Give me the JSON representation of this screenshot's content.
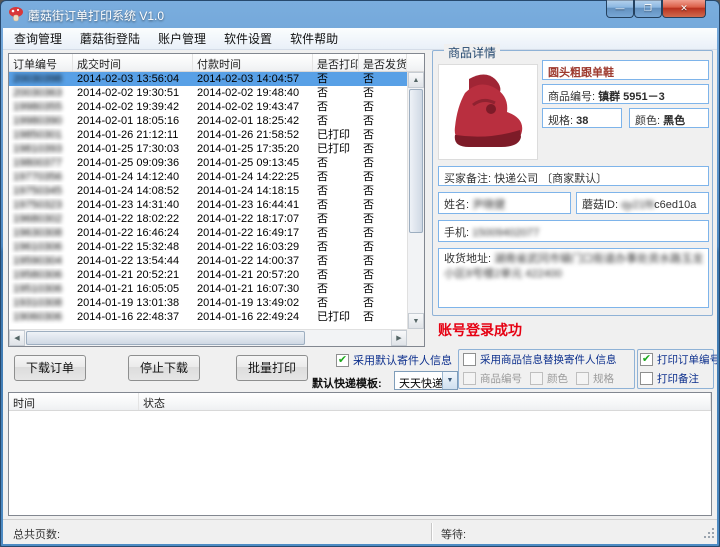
{
  "window": {
    "title": "蘑菇街订单打印系统 V1.0",
    "controls": {
      "minimize": "—",
      "maximize": "❐",
      "close": "✕"
    }
  },
  "menu": {
    "items": [
      "查询管理",
      "蘑菇街登陆",
      "账户管理",
      "软件设置",
      "软件帮助"
    ]
  },
  "orders": {
    "columns": [
      "订单编号",
      "成交时间",
      "付款时间",
      "是否打印",
      "是否发货"
    ],
    "selected_index": 0,
    "rows": [
      [
        "20030398",
        "2014-02-03 13:56:04",
        "2014-02-03 14:04:57",
        "否",
        "否"
      ],
      [
        "20030363",
        "2014-02-02 19:30:51",
        "2014-02-02 19:48:40",
        "否",
        "否"
      ],
      [
        "19980355",
        "2014-02-02 19:39:42",
        "2014-02-02 19:43:47",
        "否",
        "否"
      ],
      [
        "19980390",
        "2014-02-01 18:05:16",
        "2014-02-01 18:25:42",
        "否",
        "否"
      ],
      [
        "19850301",
        "2014-01-26 21:12:11",
        "2014-01-26 21:58:52",
        "已打印",
        "否"
      ],
      [
        "19810393",
        "2014-01-25 17:30:03",
        "2014-01-25 17:35:20",
        "已打印",
        "否"
      ],
      [
        "19800377",
        "2014-01-25 09:09:36",
        "2014-01-25 09:13:45",
        "否",
        "否"
      ],
      [
        "19770356",
        "2014-01-24 14:12:40",
        "2014-01-24 14:22:25",
        "否",
        "否"
      ],
      [
        "19750345",
        "2014-01-24 14:08:52",
        "2014-01-24 14:18:15",
        "否",
        "否"
      ],
      [
        "19750323",
        "2014-01-23 14:31:40",
        "2014-01-23 16:44:41",
        "否",
        "否"
      ],
      [
        "19680302",
        "2014-01-22 18:02:22",
        "2014-01-22 18:17:07",
        "否",
        "否"
      ],
      [
        "19630308",
        "2014-01-22 16:46:24",
        "2014-01-22 16:49:17",
        "否",
        "否"
      ],
      [
        "19610306",
        "2014-01-22 15:32:48",
        "2014-01-22 16:03:29",
        "否",
        "否"
      ],
      [
        "19590304",
        "2014-01-22 13:54:44",
        "2014-01-22 14:00:37",
        "否",
        "否"
      ],
      [
        "19580306",
        "2014-01-21 20:52:21",
        "2014-01-21 20:57:20",
        "否",
        "否"
      ],
      [
        "19510306",
        "2014-01-21 16:05:05",
        "2014-01-21 16:07:30",
        "否",
        "否"
      ],
      [
        "19310308",
        "2014-01-19 13:01:38",
        "2014-01-19 13:49:02",
        "否",
        "否"
      ],
      [
        "19060306",
        "2014-01-16 22:48:37",
        "2014-01-16 22:49:24",
        "已打印",
        "否"
      ]
    ]
  },
  "product": {
    "panel_title": "商品详情",
    "name": "圆头粗跟单鞋",
    "sku_label": "商品编号:",
    "sku_value": "镇群  5951－3",
    "spec_label": "规格:",
    "spec_value": "38",
    "color_label": "颜色:",
    "color_value": "黑色",
    "remark_label": "买家备注:",
    "remark_value": "快递公司 〔商家默认〕",
    "buyer_name_label": "姓名:",
    "buyer_name_value": "尹晓健",
    "mogu_id_label": "蘑菇ID:",
    "mogu_id_blur": "qy21f8",
    "mogu_id_clear": "c6ed10a",
    "phone_label": "手机:",
    "phone_value": "15009402077",
    "address_label": "收货地址:",
    "address_value": "湖南省武冈市辕门口街道办事处资水路玉龙小区8号楼2单元 422400"
  },
  "status": {
    "login_message": "账号登录成功"
  },
  "controls": {
    "download_button": "下载订单",
    "stop_button": "停止下载",
    "batch_print_button": "批量打印",
    "default_sender_checkbox": "采用默认寄件人信息",
    "template_label": "默认快递模板:",
    "template_value": "天天快递",
    "replace_sender_checkbox": "采用商品信息替换寄件人信息",
    "replace_options": [
      "商品编号",
      "颜色",
      "规格"
    ],
    "print_order_no_checkbox": "打印订单编号",
    "print_remark_checkbox": "打印备注",
    "check_glyph": "✔"
  },
  "log": {
    "columns": [
      "时间",
      "状态"
    ]
  },
  "statusbar": {
    "total_pages_label": "总共页数:",
    "waiting_label": "等待:"
  },
  "colors": {
    "titlebar_blue": "#4d89c3",
    "selection_blue": "#58a0e6",
    "login_red": "#e60012",
    "check_green": "#1daa1d",
    "field_border_blue": "#7eb4ea"
  }
}
